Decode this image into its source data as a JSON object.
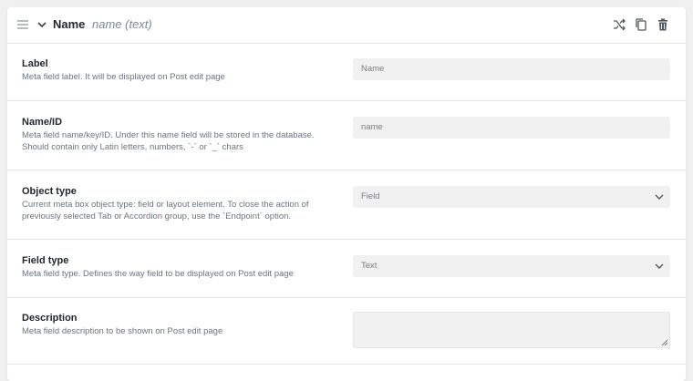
{
  "header": {
    "title": "Name",
    "subtitle": "name (text)",
    "icons": [
      "drag-handle-icon",
      "chevron-down-icon",
      "shuffle-icon",
      "copy-icon",
      "trash-icon"
    ]
  },
  "fields": [
    {
      "label": "Label",
      "description": "Meta field label. It will be displayed on Post edit page",
      "control": "input",
      "value": "",
      "placeholder": "Name"
    },
    {
      "label": "Name/ID",
      "description": "Meta field name/key/ID. Under this name field will be stored in the database. Should contain only Latin letters, numbers, `-` or `_` chars",
      "control": "input",
      "value": "",
      "placeholder": "name"
    },
    {
      "label": "Object type",
      "description": "Current meta box object type: field or layout element. To close the action of previously selected Tab or Accordion group, use the `Endpoint` option.",
      "control": "select",
      "value": "Field"
    },
    {
      "label": "Field type",
      "description": "Meta field type. Defines the way field to be displayed on Post edit page",
      "control": "select",
      "value": "Text"
    },
    {
      "label": "Description",
      "description": "Meta field description to be shown on Post edit page",
      "control": "textarea",
      "value": ""
    }
  ]
}
